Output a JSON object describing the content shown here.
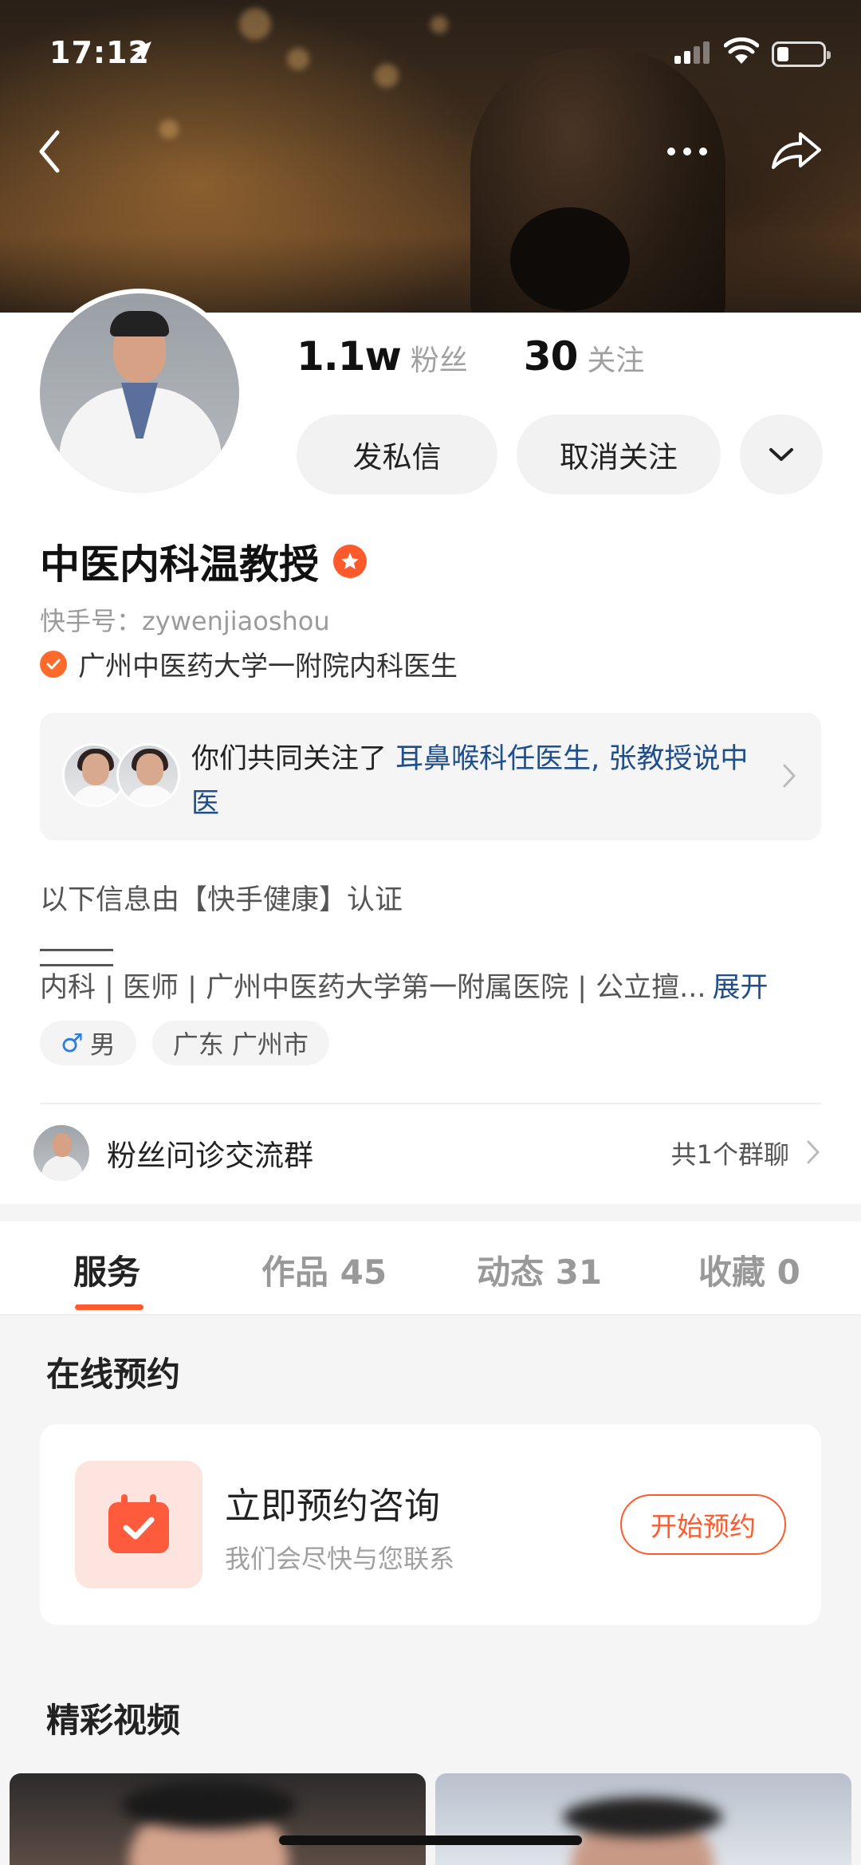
{
  "status_bar": {
    "time": "17:12"
  },
  "profile": {
    "followers_num": "1.1w",
    "followers_label": "粉丝",
    "following_num": "30",
    "following_label": "关注",
    "message_button": "发私信",
    "unfollow_button": "取消关注",
    "name": "中医内科温教授",
    "kuaishou_id": "快手号：zywenjiaoshou",
    "certification": "广州中医药大学一附院内科医生"
  },
  "mutual": {
    "prefix": "你们共同关注了 ",
    "link1": "耳鼻喉科任医生",
    "sep": ", ",
    "link2": "张教授说中医"
  },
  "info": {
    "title": "以下信息由【快手健康】认证",
    "detail": "内科 | 医师 | 广州中医药大学第一附属医院 | 公立擅...",
    "expand": "展开",
    "gender": "男",
    "location": "广东 广州市"
  },
  "group": {
    "name": "粉丝问诊交流群",
    "count": "共1个群聊"
  },
  "tabs": [
    {
      "label": "服务"
    },
    {
      "label": "作品 45"
    },
    {
      "label": "动态 31"
    },
    {
      "label": "收藏 0"
    }
  ],
  "services": {
    "section_title": "在线预约",
    "card_title": "立即预约咨询",
    "card_subtitle": "我们会尽快与您联系",
    "book_button": "开始预约"
  },
  "videos": {
    "section_title": "精彩视频"
  },
  "colors": {
    "accent": "#fe5a2c",
    "link": "#1f4e8c",
    "male": "#2a7de1"
  }
}
